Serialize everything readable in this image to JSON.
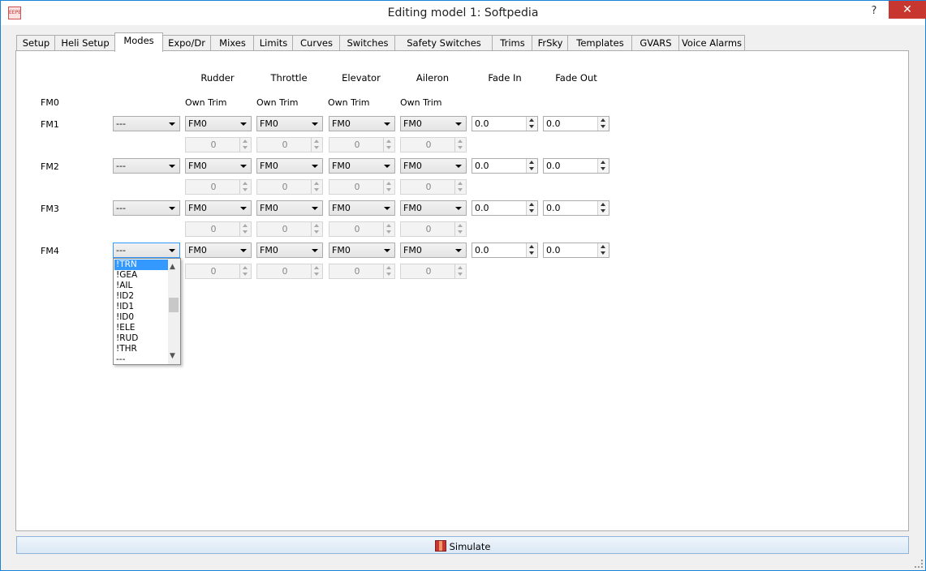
{
  "window": {
    "title": "Editing model 1: Softpedia",
    "help_label": "?",
    "close_label": "✕"
  },
  "tabs": [
    {
      "label": "Setup"
    },
    {
      "label": "Heli Setup"
    },
    {
      "label": "Modes"
    },
    {
      "label": "Expo/Dr"
    },
    {
      "label": "Mixes"
    },
    {
      "label": "Limits"
    },
    {
      "label": "Curves"
    },
    {
      "label": "Switches"
    },
    {
      "label": "Safety Switches"
    },
    {
      "label": "Trims"
    },
    {
      "label": "FrSky"
    },
    {
      "label": "Templates"
    },
    {
      "label": "GVARS"
    },
    {
      "label": "Voice Alarms"
    }
  ],
  "active_tab": "Modes",
  "columns": [
    "Rudder",
    "Throttle",
    "Elevator",
    "Aileron",
    "Fade In",
    "Fade Out"
  ],
  "fm0": {
    "label": "FM0",
    "trims": [
      "Own Trim",
      "Own Trim",
      "Own Trim",
      "Own Trim"
    ]
  },
  "modes": [
    {
      "label": "FM1",
      "switch": "---",
      "trims": [
        "FM0",
        "FM0",
        "FM0",
        "FM0"
      ],
      "trim_values": [
        "0",
        "0",
        "0",
        "0"
      ],
      "fade_in": "0.0",
      "fade_out": "0.0"
    },
    {
      "label": "FM2",
      "switch": "---",
      "trims": [
        "FM0",
        "FM0",
        "FM0",
        "FM0"
      ],
      "trim_values": [
        "0",
        "0",
        "0",
        "0"
      ],
      "fade_in": "0.0",
      "fade_out": "0.0"
    },
    {
      "label": "FM3",
      "switch": "---",
      "trims": [
        "FM0",
        "FM0",
        "FM0",
        "FM0"
      ],
      "trim_values": [
        "0",
        "0",
        "0",
        "0"
      ],
      "fade_in": "0.0",
      "fade_out": "0.0"
    },
    {
      "label": "FM4",
      "switch": "---",
      "trims": [
        "FM0",
        "FM0",
        "FM0",
        "FM0"
      ],
      "trim_values": [
        "0",
        "0",
        "0",
        "0"
      ],
      "fade_in": "0.0",
      "fade_out": "0.0"
    }
  ],
  "switch_dropdown": {
    "items": [
      "!TRN",
      "!GEA",
      "!AIL",
      "!ID2",
      "!ID1",
      "!ID0",
      "!ELE",
      "!RUD",
      "!THR",
      "---"
    ],
    "selected": "!TRN"
  },
  "simulate_label": "Simulate",
  "colors": {
    "accent": "#3399ff",
    "close": "#c7372f"
  }
}
